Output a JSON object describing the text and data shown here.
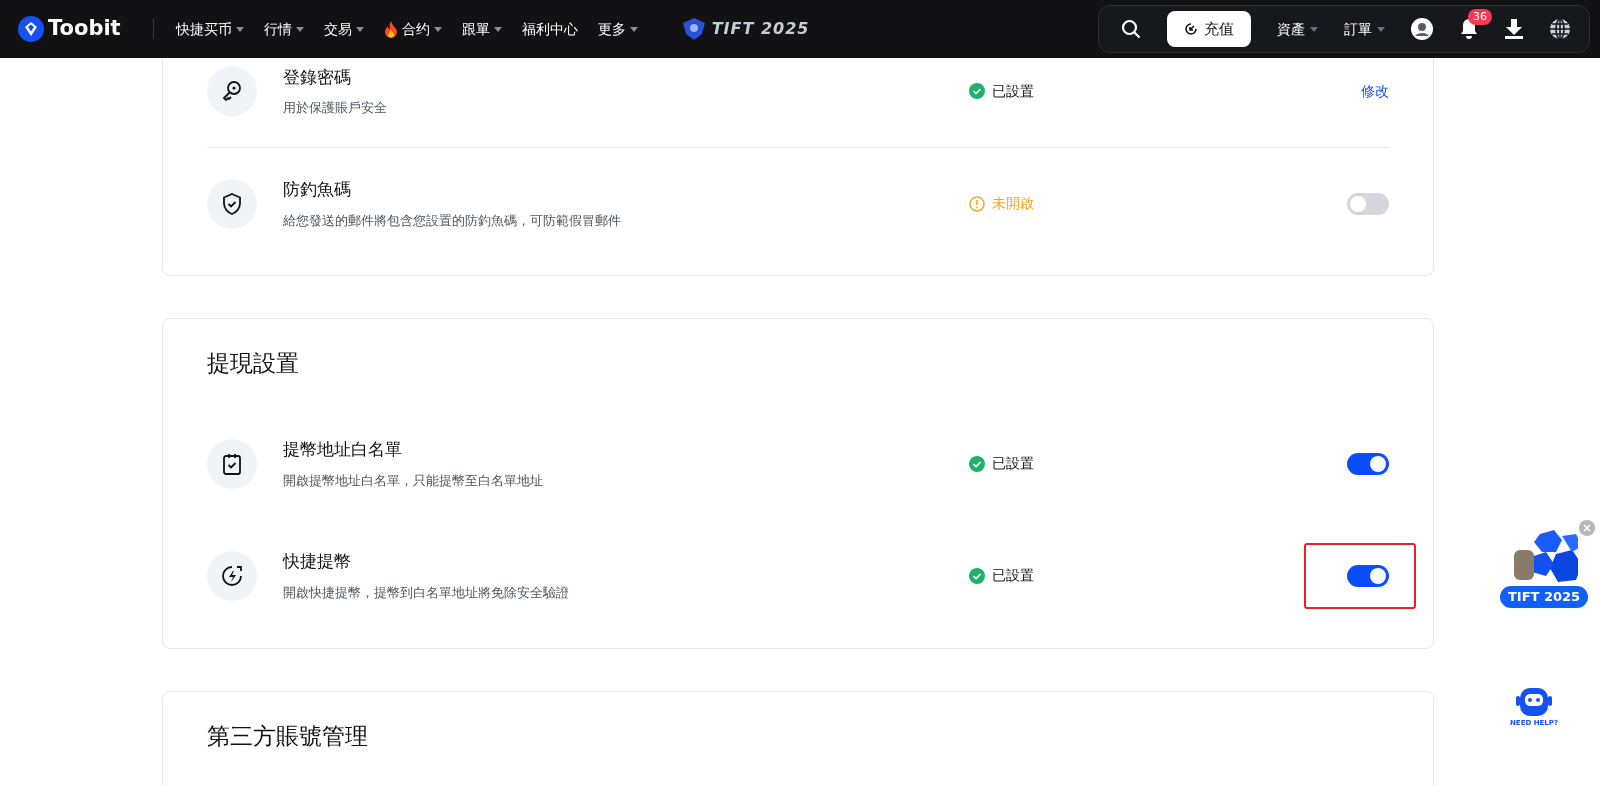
{
  "navbar": {
    "logo_text": "Toobit",
    "menu": [
      {
        "label": "快捷买币",
        "dropdown": true,
        "fire": false
      },
      {
        "label": "行情",
        "dropdown": true,
        "fire": false
      },
      {
        "label": "交易",
        "dropdown": true,
        "fire": false
      },
      {
        "label": "合约",
        "dropdown": true,
        "fire": true
      },
      {
        "label": "跟單",
        "dropdown": true,
        "fire": false
      },
      {
        "label": "福利中心",
        "dropdown": false,
        "fire": false
      },
      {
        "label": "更多",
        "dropdown": true,
        "fire": false
      }
    ],
    "event_logo": "TIFT 2025",
    "deposit_button": "充值",
    "right_menu": [
      {
        "label": "資產",
        "dropdown": true
      },
      {
        "label": "訂單",
        "dropdown": true
      }
    ],
    "notification_count": "36"
  },
  "sections": [
    {
      "items": [
        {
          "title": "登錄密碼",
          "description": "用於保護賬戶安全",
          "status": "已設置",
          "status_set": true,
          "action": {
            "kind": "link",
            "label": "修改"
          }
        },
        {
          "title": "防釣魚碼",
          "description": "給您發送的郵件將包含您設置的防釣魚碼，可防範假冒郵件",
          "status": "未開啟",
          "status_set": false,
          "action": {
            "kind": "toggle",
            "on": false,
            "highlighted": false
          }
        }
      ]
    },
    {
      "title": "提現設置",
      "items": [
        {
          "title": "提幣地址白名單",
          "description": "開啟提幣地址白名單，只能提幣至白名單地址",
          "status": "已設置",
          "status_set": true,
          "action": {
            "kind": "toggle",
            "on": true,
            "highlighted": false
          }
        },
        {
          "title": "快捷提幣",
          "description": "開啟快捷提幣，提幣到白名單地址將免除安全驗證",
          "status": "已設置",
          "status_set": true,
          "action": {
            "kind": "toggle",
            "on": true,
            "highlighted": true
          }
        }
      ]
    },
    {
      "title": "第三方賬號管理"
    }
  ],
  "floating": {
    "promo_label": "TIFT 2025",
    "help_label": "NEED HELP?"
  }
}
